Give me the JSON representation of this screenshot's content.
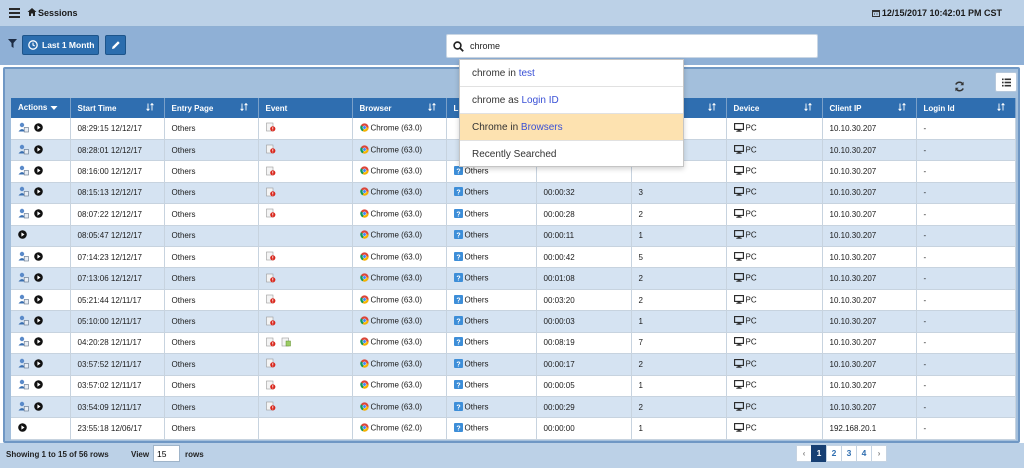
{
  "header": {
    "title": "Sessions",
    "datetime": "12/15/2017 10:42:01 PM CST"
  },
  "toolbar": {
    "range_label": "Last 1 Month"
  },
  "search": {
    "value": "chrome"
  },
  "suggestions": [
    {
      "term": "chrome",
      "connector": " in ",
      "target": "test"
    },
    {
      "term": "chrome",
      "connector": " as ",
      "target": "Login ID"
    },
    {
      "term": "Chrome",
      "connector": " in ",
      "target": "Browsers"
    },
    {
      "term": "Recently Searched",
      "connector": "",
      "target": ""
    }
  ],
  "table": {
    "columns": [
      "Actions",
      "Start Time",
      "Entry Page",
      "Event",
      "Browser",
      "L",
      "",
      "",
      "Device",
      "Client IP",
      "Login Id"
    ],
    "rows": [
      {
        "start": "08:29:15 12/12/17",
        "entry": "Others",
        "event": [
          "alert"
        ],
        "browser": "Chrome (63.0)",
        "os": "",
        "dur": "",
        "pages": "",
        "device": "PC",
        "ip": "10.10.30.207",
        "login": "-"
      },
      {
        "start": "08:28:01 12/12/17",
        "entry": "Others",
        "event": [
          "alert"
        ],
        "browser": "Chrome (63.0)",
        "os": "",
        "dur": "",
        "pages": "",
        "device": "PC",
        "ip": "10.10.30.207",
        "login": "-"
      },
      {
        "start": "08:16:00 12/12/17",
        "entry": "Others",
        "event": [
          "alert"
        ],
        "browser": "Chrome (63.0)",
        "os": "Others",
        "dur": "",
        "pages": "",
        "device": "PC",
        "ip": "10.10.30.207",
        "login": "-"
      },
      {
        "start": "08:15:13 12/12/17",
        "entry": "Others",
        "event": [
          "alert"
        ],
        "browser": "Chrome (63.0)",
        "os": "Others",
        "dur": "00:00:32",
        "pages": "3",
        "device": "PC",
        "ip": "10.10.30.207",
        "login": "-"
      },
      {
        "start": "08:07:22 12/12/17",
        "entry": "Others",
        "event": [
          "alert"
        ],
        "browser": "Chrome (63.0)",
        "os": "Others",
        "dur": "00:00:28",
        "pages": "2",
        "device": "PC",
        "ip": "10.10.30.207",
        "login": "-"
      },
      {
        "start": "08:05:47 12/12/17",
        "entry": "Others",
        "event": [],
        "browser": "Chrome (63.0)",
        "os": "Others",
        "dur": "00:00:11",
        "pages": "1",
        "device": "PC",
        "ip": "10.10.30.207",
        "login": "-"
      },
      {
        "start": "07:14:23 12/12/17",
        "entry": "Others",
        "event": [
          "alert"
        ],
        "browser": "Chrome (63.0)",
        "os": "Others",
        "dur": "00:00:42",
        "pages": "5",
        "device": "PC",
        "ip": "10.10.30.207",
        "login": "-"
      },
      {
        "start": "07:13:06 12/12/17",
        "entry": "Others",
        "event": [
          "alert"
        ],
        "browser": "Chrome (63.0)",
        "os": "Others",
        "dur": "00:01:08",
        "pages": "2",
        "device": "PC",
        "ip": "10.10.30.207",
        "login": "-"
      },
      {
        "start": "05:21:44 12/11/17",
        "entry": "Others",
        "event": [
          "alert"
        ],
        "browser": "Chrome (63.0)",
        "os": "Others",
        "dur": "00:03:20",
        "pages": "2",
        "device": "PC",
        "ip": "10.10.30.207",
        "login": "-"
      },
      {
        "start": "05:10:00 12/11/17",
        "entry": "Others",
        "event": [
          "alert"
        ],
        "browser": "Chrome (63.0)",
        "os": "Others",
        "dur": "00:00:03",
        "pages": "1",
        "device": "PC",
        "ip": "10.10.30.207",
        "login": "-"
      },
      {
        "start": "04:20:28 12/11/17",
        "entry": "Others",
        "event": [
          "alert",
          "page"
        ],
        "browser": "Chrome (63.0)",
        "os": "Others",
        "dur": "00:08:19",
        "pages": "7",
        "device": "PC",
        "ip": "10.10.30.207",
        "login": "-"
      },
      {
        "start": "03:57:52 12/11/17",
        "entry": "Others",
        "event": [
          "alert"
        ],
        "browser": "Chrome (63.0)",
        "os": "Others",
        "dur": "00:00:17",
        "pages": "2",
        "device": "PC",
        "ip": "10.10.30.207",
        "login": "-"
      },
      {
        "start": "03:57:02 12/11/17",
        "entry": "Others",
        "event": [
          "alert"
        ],
        "browser": "Chrome (63.0)",
        "os": "Others",
        "dur": "00:00:05",
        "pages": "1",
        "device": "PC",
        "ip": "10.10.30.207",
        "login": "-"
      },
      {
        "start": "03:54:09 12/11/17",
        "entry": "Others",
        "event": [
          "alert"
        ],
        "browser": "Chrome (63.0)",
        "os": "Others",
        "dur": "00:00:29",
        "pages": "2",
        "device": "PC",
        "ip": "10.10.30.207",
        "login": "-"
      },
      {
        "start": "23:55:18 12/06/17",
        "entry": "Others",
        "event": [],
        "browser": "Chrome (62.0)",
        "os": "Others",
        "dur": "00:00:00",
        "pages": "1",
        "device": "PC",
        "ip": "192.168.20.1",
        "login": "-"
      }
    ],
    "row_has_user_icon": [
      true,
      true,
      true,
      true,
      true,
      false,
      true,
      true,
      true,
      true,
      true,
      true,
      true,
      true,
      false
    ]
  },
  "footer": {
    "showing": "Showing 1 to 15 of 56 rows",
    "view_label": "View",
    "page_size": "15",
    "rows_label": "rows",
    "pages": [
      "1",
      "2",
      "3",
      "4"
    ],
    "current_page": "1"
  },
  "colors": {
    "header_blue": "#2f6eb0",
    "row_alt": "#d5e3f2",
    "suggest_active": "#fde2b0",
    "link_blue": "#3950d6"
  }
}
